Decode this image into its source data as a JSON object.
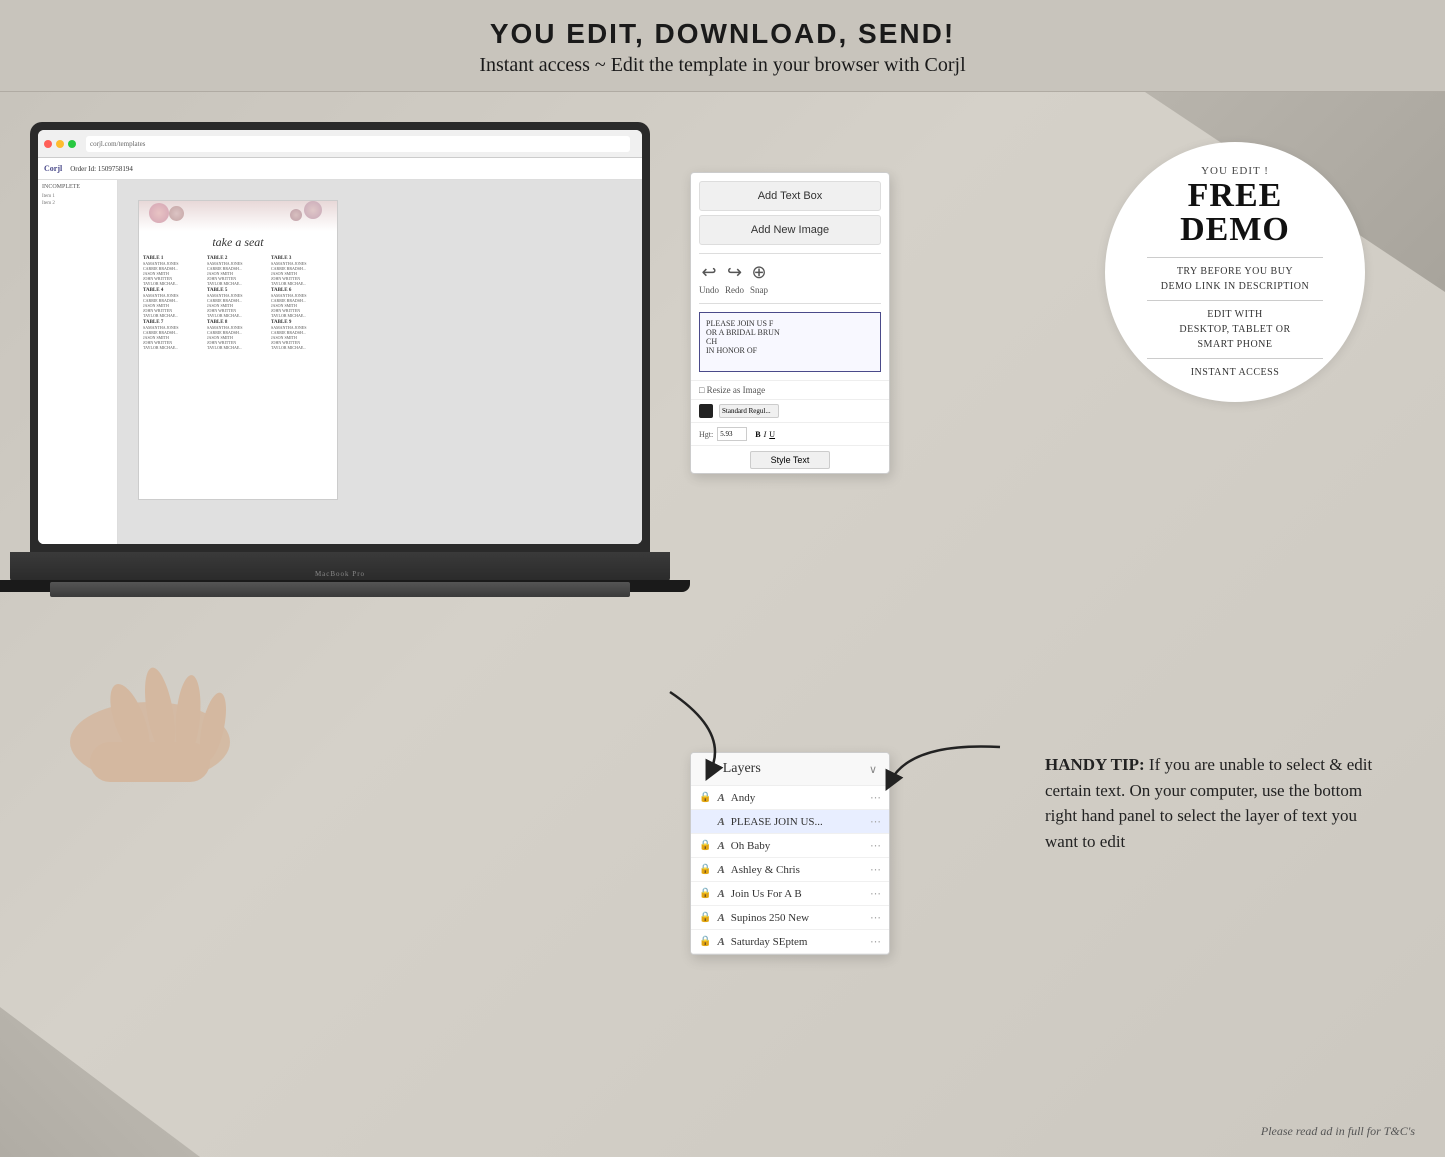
{
  "topBanner": {
    "title": "YOU EDIT, DOWNLOAD, SEND!",
    "subtitle": "Instant access ~ Edit the template in your browser with Corjl"
  },
  "corjl": {
    "logo": "Corjl",
    "orderLabel": "Order Id: 1509758194",
    "panel": {
      "addTextBox": "Add Text Box",
      "addNewImage": "Add New Image",
      "textPreview": "PLEASE JOIN US F\nOR A BRIDAL BRUN\nCH\nIN HONOR OF",
      "undo": "Undo",
      "redo": "Redo",
      "snap": "Snap"
    },
    "layers": {
      "title": "Layers",
      "items": [
        {
          "name": "Andy",
          "type": "A",
          "locked": true,
          "active": false
        },
        {
          "name": "PLEASE JOIN US...",
          "type": "A",
          "locked": false,
          "active": true
        },
        {
          "name": "Oh Baby",
          "type": "A",
          "locked": true,
          "active": false
        },
        {
          "name": "Ashley & Chris",
          "type": "A",
          "locked": true,
          "active": false
        },
        {
          "name": "Join Us For A B",
          "type": "A",
          "locked": true,
          "active": false
        },
        {
          "name": "Supinos 250 New",
          "type": "A",
          "locked": true,
          "active": false
        },
        {
          "name": "Saturday SEptem",
          "type": "A",
          "locked": true,
          "active": false
        }
      ]
    }
  },
  "freeDemoCircle": {
    "youEdit": "YOU EDIT !",
    "free": "FREE",
    "demo": "DEMO",
    "tryBeforeYouBuy": "TRY BEFORE YOU BUY",
    "demoLinkInDescription": "DEMO LINK IN DESCRIPTION",
    "editWith": "EDIT WITH",
    "platforms": "DESKTOP, TABLET OR\nSMART PHONE",
    "instantAccess": "INSTANT ACCESS"
  },
  "handyTip": {
    "label": "HANDY TIP:",
    "text": "If you are unable to select & edit certain text. On your computer, use the bottom right hand panel to select the layer of text you want to edit"
  },
  "laptop": {
    "brand": "MacBook Pro"
  },
  "seating": {
    "title": "take a seat",
    "tables": [
      {
        "label": "TABLE 1"
      },
      {
        "label": "TABLE 2"
      },
      {
        "label": "TABLE 3"
      },
      {
        "label": "TABLE 4"
      },
      {
        "label": "TABLE 5"
      },
      {
        "label": "TABLE 6"
      },
      {
        "label": "TABLE 7"
      },
      {
        "label": "TABLE 8"
      },
      {
        "label": "TABLE 9"
      }
    ]
  },
  "tcText": "Please read ad in full for T&C's"
}
